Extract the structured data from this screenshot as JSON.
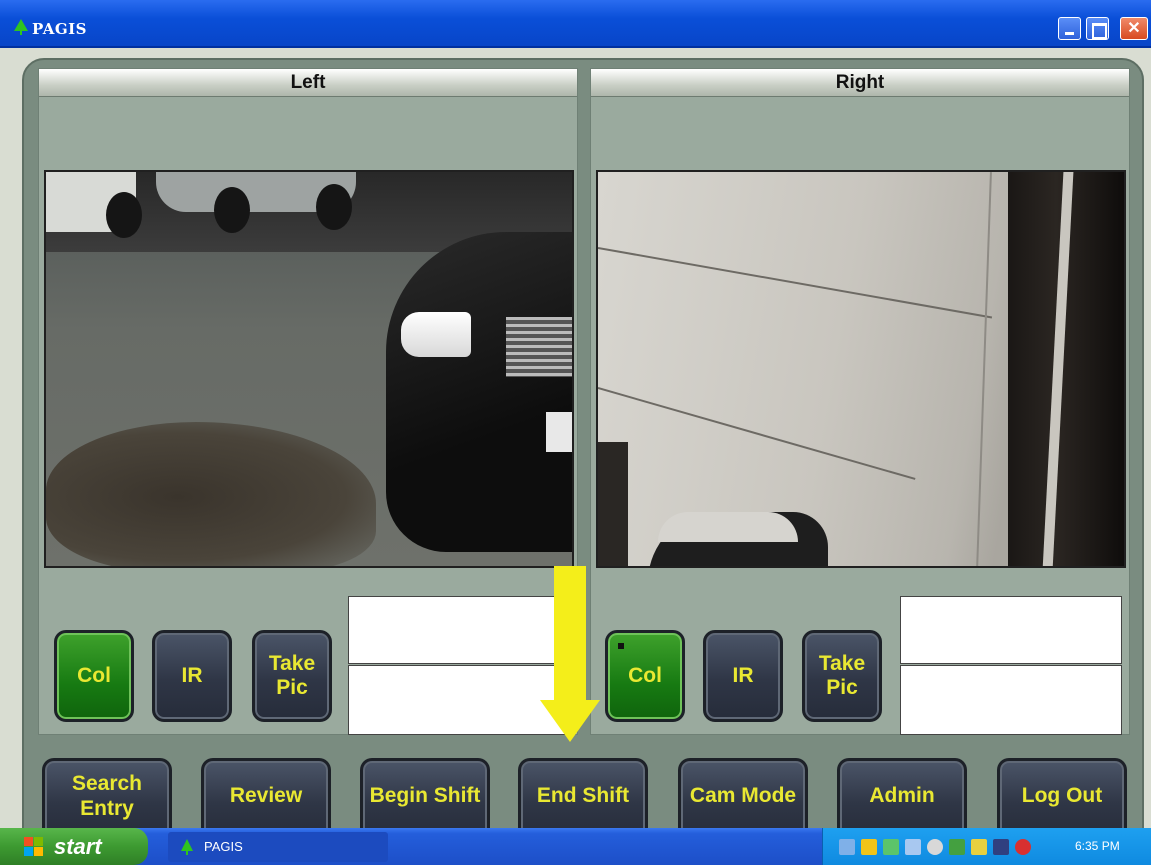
{
  "window": {
    "title": "PAGIS"
  },
  "cameras": {
    "left": {
      "header": "Left",
      "buttons": {
        "col": "Col",
        "ir": "IR",
        "take_pic_line1": "Take",
        "take_pic_line2": "Pic"
      }
    },
    "right": {
      "header": "Right",
      "buttons": {
        "col": "Col",
        "ir": "IR",
        "take_pic_line1": "Take",
        "take_pic_line2": "Pic"
      }
    }
  },
  "nav": {
    "search_entry_line1": "Search",
    "search_entry_line2": "Entry",
    "review": "Review",
    "begin_shift": "Begin Shift",
    "end_shift": "End Shift",
    "cam_mode": "Cam Mode",
    "admin": "Admin",
    "log_out": "Log Out"
  },
  "taskbar": {
    "start": "start",
    "task_item": "PAGIS",
    "clock": "6:35 PM"
  },
  "colors": {
    "button_text": "#e9e832",
    "active_button": "#177a12",
    "arrow": "#f4ee1a"
  },
  "icons": [
    "app-tree-icon",
    "minimize-icon",
    "maximize-icon",
    "close-icon",
    "windows-flag-icon",
    "tray-icons"
  ]
}
